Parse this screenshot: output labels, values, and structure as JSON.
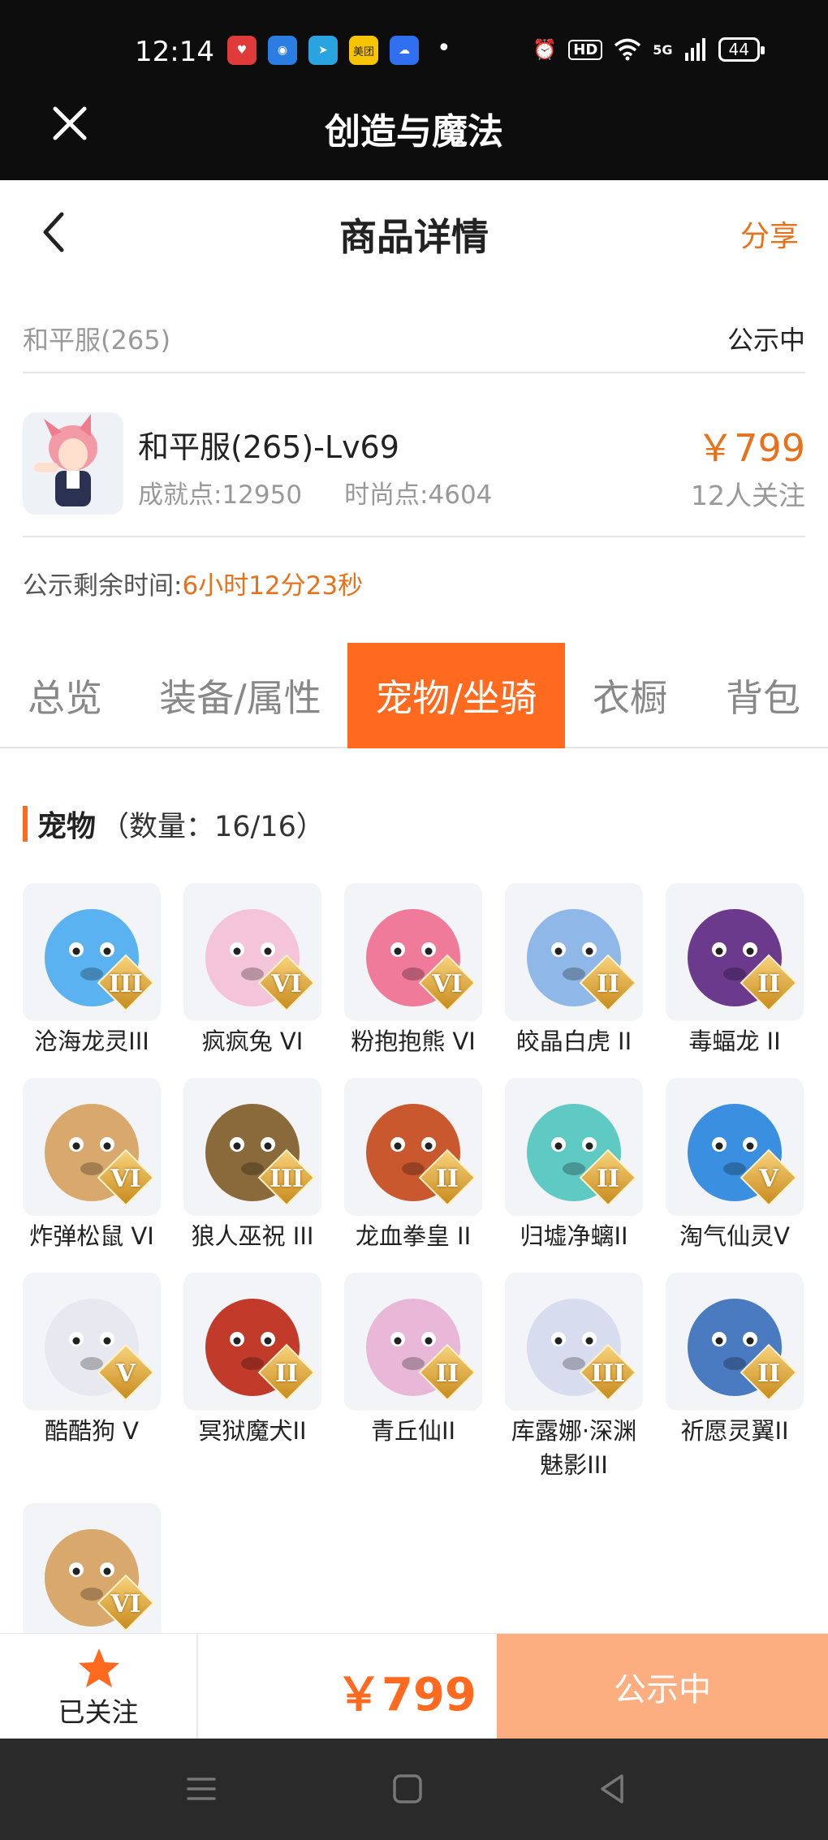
{
  "status_bar": {
    "time": "12:14",
    "apps": [
      {
        "icon": "red-heart-app-icon",
        "color": "#e03a3a"
      },
      {
        "icon": "blue-app-icon",
        "color": "#2a7de1"
      },
      {
        "icon": "telegram-icon",
        "color": "#2aa3e1"
      },
      {
        "icon": "meituan-icon",
        "color": "#f7c400",
        "label": "美团"
      },
      {
        "icon": "blue-chat-app-icon",
        "color": "#2f6ff0"
      }
    ],
    "more_indicator": "•",
    "hd": "HD",
    "network": "5G",
    "battery": "44"
  },
  "app_header": {
    "title": "创造与魔法"
  },
  "page_header": {
    "title": "商品详情",
    "share": "分享"
  },
  "server": {
    "name": "和平服(265)",
    "status": "公示中"
  },
  "character": {
    "name": "和平服(265)-Lv69",
    "achievement": "成就点:12950",
    "fashion": "时尚点:4604",
    "price": "￥799",
    "followers": "12人关注"
  },
  "timer": {
    "label": "公示剩余时间:",
    "value": "6小时12分23秒"
  },
  "tabs": [
    {
      "label": "总览",
      "active": false
    },
    {
      "label": "装备/属性",
      "active": false
    },
    {
      "label": "宠物/坐骑",
      "active": true
    },
    {
      "label": "衣橱",
      "active": false
    },
    {
      "label": "背包",
      "active": false
    }
  ],
  "pets_section": {
    "title": "宠物",
    "count": "（数量：16/16）"
  },
  "pets": [
    {
      "name": "沧海龙灵III",
      "grade": "III",
      "color": "#5ab3f0"
    },
    {
      "name": "疯疯兔 VI",
      "grade": "VI",
      "color": "#f4c4d8"
    },
    {
      "name": "粉抱抱熊 VI",
      "grade": "VI",
      "color": "#f07a9a"
    },
    {
      "name": "皎晶白虎 II",
      "grade": "II",
      "color": "#8fb8e8"
    },
    {
      "name": "毒蝠龙 II",
      "grade": "II",
      "color": "#6b3a8c"
    },
    {
      "name": "炸弹松鼠 VI",
      "grade": "VI",
      "color": "#d9a86c"
    },
    {
      "name": "狼人巫祝 III",
      "grade": "III",
      "color": "#8a6a3a"
    },
    {
      "name": "龙血拳皇 II",
      "grade": "II",
      "color": "#c9582e"
    },
    {
      "name": "归墟净螭II",
      "grade": "II",
      "color": "#5fc9c4"
    },
    {
      "name": "淘气仙灵V",
      "grade": "V",
      "color": "#3a8fe0"
    },
    {
      "name": "酷酷狗 V",
      "grade": "V",
      "color": "#e8e8f0"
    },
    {
      "name": "冥狱魔犬II",
      "grade": "II",
      "color": "#c23a2a"
    },
    {
      "name": "青丘仙II",
      "grade": "II",
      "color": "#e9b7d8"
    },
    {
      "name": "库露娜·深渊魅影III",
      "grade": "III",
      "color": "#d8dcef"
    },
    {
      "name": "祈愿灵翼II",
      "grade": "II",
      "color": "#4a7ac0"
    },
    {
      "name": "",
      "grade": "VI",
      "color": "#d9a86c"
    }
  ],
  "bottom_bar": {
    "follow_label": "已关注",
    "price": "￥799",
    "status": "公示中"
  }
}
